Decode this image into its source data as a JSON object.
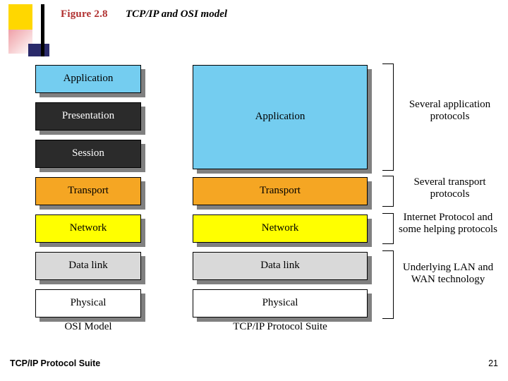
{
  "header": {
    "figure_label": "Figure 2.8",
    "figure_title": "TCP/IP and OSI model"
  },
  "osi_column": {
    "caption": "OSI Model",
    "layers": [
      {
        "label": "Application",
        "color": "#74cdf0",
        "style": "fill-blue"
      },
      {
        "label": "Presentation",
        "color": "#2b2b2b",
        "style": "fill-dark"
      },
      {
        "label": "Session",
        "color": "#2b2b2b",
        "style": "fill-dark"
      },
      {
        "label": "Transport",
        "color": "#f5a623",
        "style": "fill-orange"
      },
      {
        "label": "Network",
        "color": "#ffff00",
        "style": "fill-yellow"
      },
      {
        "label": "Data link",
        "color": "#d9d9d9",
        "style": "fill-grey"
      },
      {
        "label": "Physical",
        "color": "#ffffff",
        "style": "fill-white"
      }
    ]
  },
  "tcp_column": {
    "caption": "TCP/IP Protocol Suite",
    "layers": [
      {
        "label": "Application",
        "color": "#74cdf0",
        "style": "fill-blue"
      },
      {
        "label": "Transport",
        "color": "#f5a623",
        "style": "fill-orange"
      },
      {
        "label": "Network",
        "color": "#ffff00",
        "style": "fill-yellow"
      },
      {
        "label": "Data link",
        "color": "#d9d9d9",
        "style": "fill-grey"
      },
      {
        "label": "Physical",
        "color": "#ffffff",
        "style": "fill-white"
      }
    ]
  },
  "annotations": [
    {
      "text": "Several application protocols"
    },
    {
      "text": "Several transport protocols"
    },
    {
      "text": "Internet Protocol and some helping protocols"
    },
    {
      "text": "Underlying LAN and WAN technology"
    }
  ],
  "footer": {
    "left": "TCP/IP Protocol Suite",
    "page": "21"
  }
}
